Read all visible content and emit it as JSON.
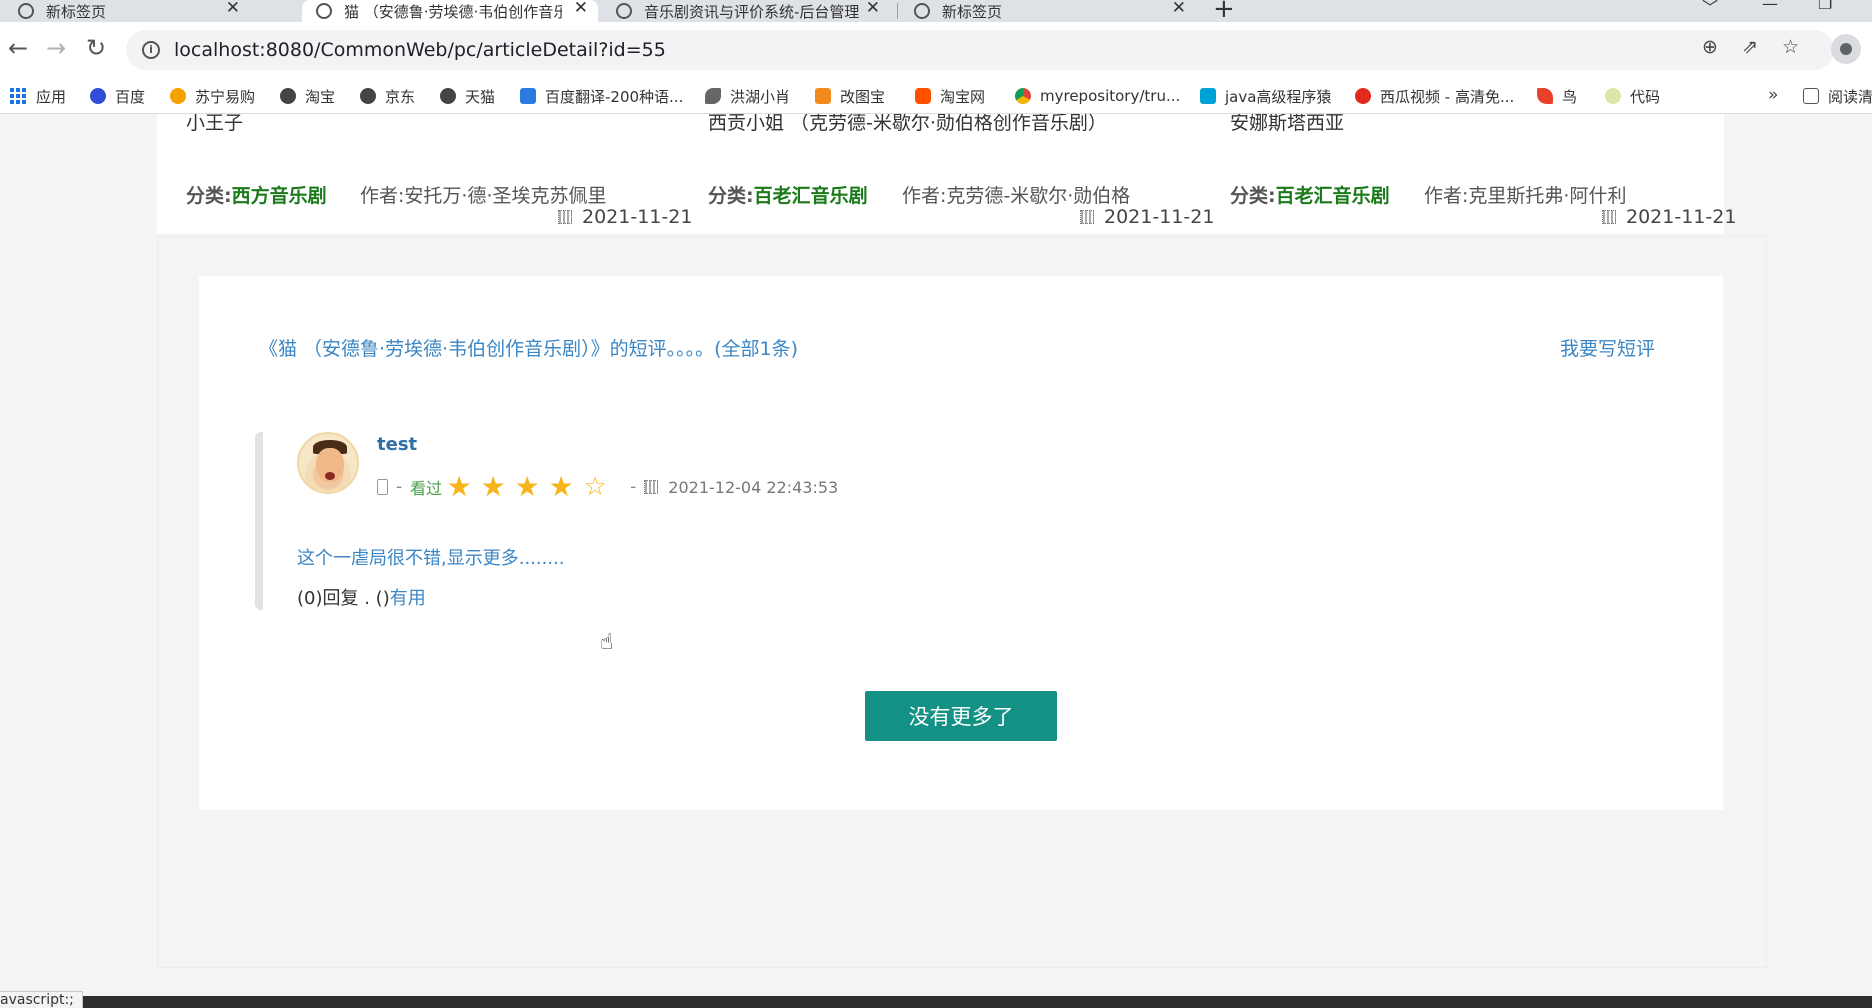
{
  "browser": {
    "tabs": [
      {
        "title": "新标签页",
        "active": false
      },
      {
        "title": "猫 （安德鲁·劳埃德·韦伯创作音乐",
        "active": true
      },
      {
        "title": "音乐剧资讯与评价系统-后台管理",
        "active": false
      },
      {
        "title": "新标签页",
        "active": false
      }
    ],
    "new_tab_glyph": "+",
    "url": "localhost:8080/CommonWeb/pc/articleDetail?id=55",
    "bookmarks": [
      {
        "label": "应用",
        "icon": "apps-grid-icon"
      },
      {
        "label": "百度",
        "icon": "baidu-paw-icon"
      },
      {
        "label": "苏宁易购",
        "icon": "suning-lion-icon"
      },
      {
        "label": "淘宝",
        "icon": "globe-icon"
      },
      {
        "label": "京东",
        "icon": "globe-icon"
      },
      {
        "label": "天猫",
        "icon": "globe-icon"
      },
      {
        "label": "百度翻译-200种语...",
        "icon": "translate-icon"
      },
      {
        "label": "洪湖小肖",
        "icon": "bird-icon"
      },
      {
        "label": "改图宝",
        "icon": "image-edit-icon"
      },
      {
        "label": "淘宝网",
        "icon": "taobao-icon"
      },
      {
        "label": "myrepository/tru...",
        "icon": "chrome-icon"
      },
      {
        "label": "java高级程序猿",
        "icon": "bilibili-tv-icon"
      },
      {
        "label": "西瓜视频 - 高清免...",
        "icon": "xigua-play-icon"
      },
      {
        "label": "鸟",
        "icon": "bird-red-icon"
      },
      {
        "label": "代码",
        "icon": "code-leaf-icon"
      }
    ],
    "bookmarks_more": "»",
    "reading_list": "阅读清"
  },
  "related": [
    {
      "title": "小王子",
      "category_label": "分类:",
      "category": "西方音乐剧",
      "author": "作者:安托万·德·圣埃克苏佩里",
      "date": "2021-11-21"
    },
    {
      "title": "西贡小姐 （克劳德-米歇尔·勋伯格创作音乐剧）",
      "category_label": "分类:",
      "category": "百老汇音乐剧",
      "author": "作者:克劳德-米歇尔·勋伯格",
      "date": "2021-11-21"
    },
    {
      "title": "安娜斯塔西亚",
      "category_label": "分类:",
      "category": "百老汇音乐剧",
      "author": "作者:克里斯托弗·阿什利",
      "date": "2021-11-21"
    }
  ],
  "reviews": {
    "header": "《猫 （安德鲁·劳埃德·韦伯创作音乐剧）》的短评。。。。(全部1条)",
    "write_link": "我要写短评",
    "items": [
      {
        "username": "test",
        "dash": "-",
        "seen_label": "看过",
        "rating": 4,
        "rating_max": 5,
        "time_dash": "-",
        "time": "2021-12-04 22:43:53",
        "body": "这个一虐局很不错,显示更多........",
        "reply_count": "(0)回复",
        "separator": " . ",
        "useful_count": "()",
        "useful_label": "有用"
      }
    ],
    "no_more_button": "没有更多了"
  },
  "status_bar": "avascript:;"
}
